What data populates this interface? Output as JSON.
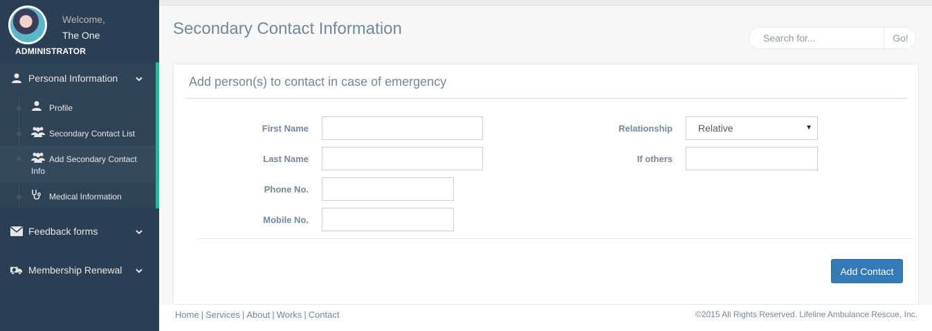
{
  "profile": {
    "welcome": "Welcome,",
    "name": "The One",
    "role": "ADMINISTRATOR"
  },
  "sidebar": {
    "sections": [
      {
        "label": "Personal Information",
        "icon": "user-icon",
        "expanded": true
      },
      {
        "label": "Feedback forms",
        "icon": "envelope-icon",
        "expanded": false
      },
      {
        "label": "Membership Renewal",
        "icon": "ambulance-icon",
        "expanded": false
      }
    ],
    "children": [
      {
        "label": "Profile",
        "icon": "user-icon"
      },
      {
        "label": "Secondary Contact List",
        "icon": "users-icon"
      },
      {
        "label_line1": "Add Secondary Contact",
        "label_line2": "Info",
        "icon": "users-icon",
        "current": true
      },
      {
        "label": "Medical Information",
        "icon": "stethoscope-icon"
      }
    ]
  },
  "page": {
    "title": "Secondary Contact Information"
  },
  "search": {
    "placeholder": "Search for...",
    "button": "Go!"
  },
  "panel": {
    "title": "Add person(s) to contact in case of emergency",
    "fields": {
      "first_name": {
        "label": "First Name",
        "value": ""
      },
      "last_name": {
        "label": "Last Name",
        "value": ""
      },
      "phone": {
        "label": "Phone No.",
        "value": ""
      },
      "mobile": {
        "label": "Mobile No.",
        "value": ""
      },
      "relationship": {
        "label": "Relationship",
        "value": "Relative"
      },
      "if_others": {
        "label": "If others",
        "value": ""
      }
    },
    "submit": "Add Contact"
  },
  "footer": {
    "links": [
      "Home",
      "Services",
      "About",
      "Works",
      "Contact"
    ],
    "separator": "|",
    "copyright": "©2015 All Rights Reserved. Lifeline Ambulance Rescue, Inc."
  },
  "colors": {
    "sidebar_bg": "#2a3f54",
    "accent": "#1abb9c",
    "primary_button": "#337ab7",
    "text": "#73879c"
  }
}
